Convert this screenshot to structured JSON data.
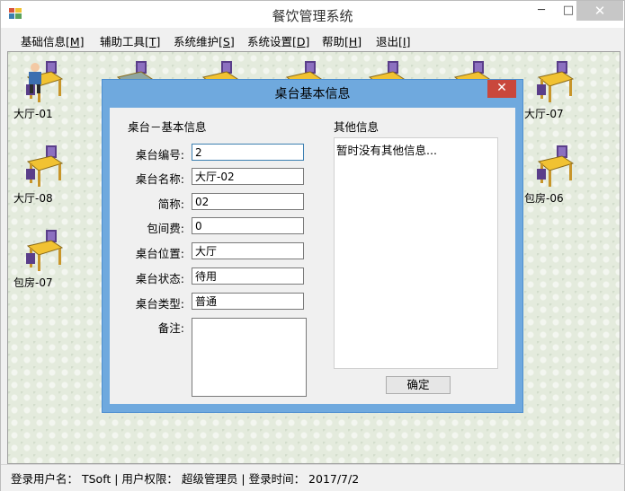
{
  "window": {
    "title": "餐饮管理系统",
    "minimize_glyph": "─",
    "maximize_glyph": "□",
    "close_glyph": "✕"
  },
  "menu": [
    {
      "label": "基础信息",
      "hotkey": "[M]"
    },
    {
      "label": "辅助工具",
      "hotkey": "[T]"
    },
    {
      "label": "系统维护",
      "hotkey": "[S]"
    },
    {
      "label": "系统设置",
      "hotkey": "[D]"
    },
    {
      "label": "帮助",
      "hotkey": "[H]"
    },
    {
      "label": "退出",
      "hotkey": "[I]"
    }
  ],
  "tables": [
    {
      "label": "大厅-01",
      "status": "occupied"
    },
    {
      "label": "",
      "status": "reserved"
    },
    {
      "label": "",
      "status": "free"
    },
    {
      "label": "",
      "status": "free"
    },
    {
      "label": "",
      "status": "free"
    },
    {
      "label": "",
      "status": "free"
    },
    {
      "label": "大厅-07",
      "status": "free"
    },
    {
      "label": "大厅-08",
      "status": "free"
    },
    {
      "label": "包房-06",
      "status": "free"
    },
    {
      "label": "包房-07",
      "status": "free"
    }
  ],
  "dialog": {
    "title": "桌台基本信息",
    "close_glyph": "✕",
    "section_basic": "桌台－基本信息",
    "section_other": "其他信息",
    "fields": [
      {
        "label": "桌台编号:",
        "value": "2"
      },
      {
        "label": "桌台名称:",
        "value": "大厅-02"
      },
      {
        "label": "简称:",
        "value": "02"
      },
      {
        "label": "包间费:",
        "value": "0"
      },
      {
        "label": "桌台位置:",
        "value": "大厅"
      },
      {
        "label": "桌台状态:",
        "value": "待用"
      },
      {
        "label": "桌台类型:",
        "value": "普通"
      }
    ],
    "remark_label": "备注:",
    "remark_value": "",
    "other_info": "暂时没有其他信息...",
    "ok_label": "确定"
  },
  "status": {
    "text": "登录用户名： TSoft | 用户权限： 超级管理员 | 登录时间： 2017/7/2"
  },
  "colors": {
    "accent": "#6fa9de",
    "dialog_close": "#c9473c",
    "desk_bg": "#e4ebdd",
    "table_top": "#f1c232",
    "chair": "#5a3e8a"
  }
}
